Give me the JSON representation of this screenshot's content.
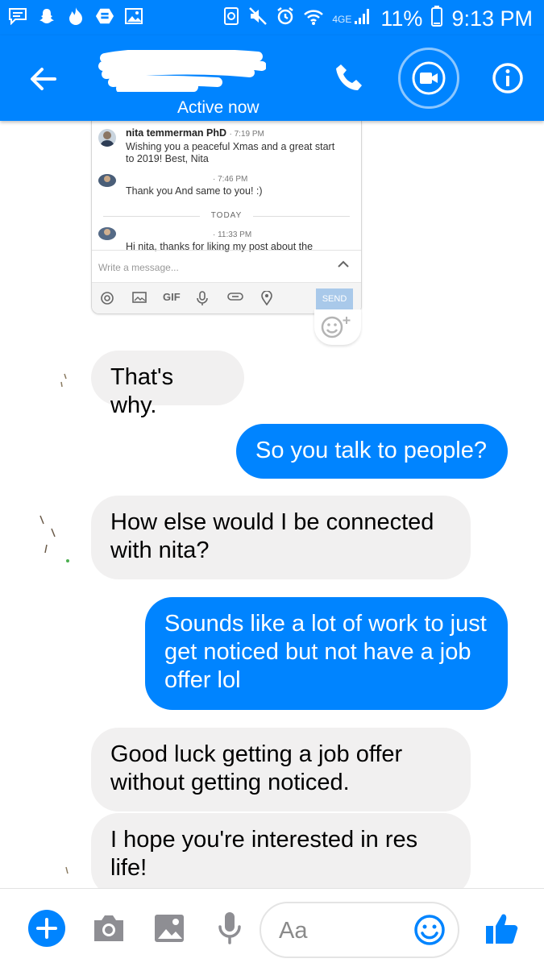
{
  "status_bar": {
    "network_label": "4GE",
    "battery": "11%",
    "time": "9:13 PM",
    "icons": [
      "message-icon",
      "snapchat-icon",
      "fire-icon",
      "rewards-icon",
      "gallery-icon",
      "recycle-icon",
      "mute-icon",
      "alarm-icon",
      "wifi-icon",
      "signal-icon",
      "battery-icon"
    ]
  },
  "header": {
    "status": "Active now",
    "icons": [
      "back-arrow-icon",
      "phone-icon",
      "video-camera-icon",
      "info-icon"
    ],
    "accent": "#0084ff"
  },
  "shared_card": {
    "msg1_name": "nita temmerman PhD",
    "msg1_time": "· 7:19 PM",
    "msg1_text_1": "Wishing you a peaceful Xmas and a great start",
    "msg1_text_2": "to 2019! Best, Nita",
    "msg2_time": "· 7:46 PM",
    "msg2_text": "Thank you And same to you! :)",
    "divider": "TODAY",
    "msg3_time": "· 11:33 PM",
    "msg3_text": "Hi nita, thanks for liking my post about the",
    "write_placeholder": "Write a message...",
    "gif_label": "GIF",
    "send_label": "SEND"
  },
  "messages": [
    {
      "side": "in",
      "text": "That's why."
    },
    {
      "side": "out",
      "text": "So you talk to people?"
    },
    {
      "side": "in",
      "text": "How else would I be connected with nita?"
    },
    {
      "side": "out",
      "text": "Sounds like a lot of work to just get noticed but not have a job offer lol"
    },
    {
      "side": "in",
      "text": "Good luck getting a job offer without getting noticed."
    },
    {
      "side": "in",
      "text": "I hope you're interested in res life!"
    }
  ],
  "composer": {
    "placeholder": "Aa",
    "icons": [
      "plus-icon",
      "camera-icon",
      "image-icon",
      "microphone-icon",
      "emoji-icon",
      "thumbs-up-icon"
    ]
  }
}
